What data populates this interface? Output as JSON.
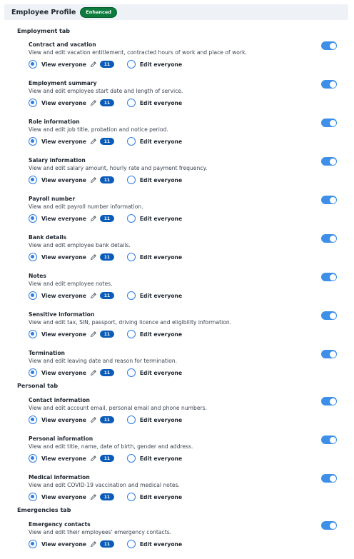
{
  "header": {
    "title": "Employee Profile",
    "badge": "Enhanced"
  },
  "option_labels": {
    "view": "View everyone",
    "edit": "Edit everyone"
  },
  "sections": [
    {
      "title": "Employment tab",
      "items": [
        {
          "title": "Contract and vacation",
          "desc": "View and edit vacation entitlement, contracted hours of work and place of work.",
          "count": "11"
        },
        {
          "title": "Employment summary",
          "desc": "View and edit employee start date and length of service.",
          "count": "11"
        },
        {
          "title": "Role information",
          "desc": "View and edit job title, probation and notice period.",
          "count": "11"
        },
        {
          "title": "Salary information",
          "desc": "View and edit salary amount, hourly rate and payment frequency.",
          "count": "11"
        },
        {
          "title": "Payroll number",
          "desc": "View and edit payroll number information.",
          "count": "11"
        },
        {
          "title": "Bank details",
          "desc": "View and edit employee bank details.",
          "count": "11"
        },
        {
          "title": "Notes",
          "desc": "View and edit employee notes.",
          "count": "11"
        },
        {
          "title": "Sensitive information",
          "desc": "View and edit tax, SIN, passport, driving licence and eligibility information.",
          "count": "11"
        },
        {
          "title": "Termination",
          "desc": "View and edit leaving date and reason for termination.",
          "count": "11"
        }
      ]
    },
    {
      "title": "Personal tab",
      "items": [
        {
          "title": "Contact information",
          "desc": "View and edit account email, personal email and phone numbers.",
          "count": "11"
        },
        {
          "title": "Personal information",
          "desc": "View and edit title, name, date of birth, gender and address.",
          "count": "11"
        },
        {
          "title": "Medical information",
          "desc": "View and edit COVID-19 vaccination and medical notes.",
          "count": "11"
        }
      ]
    },
    {
      "title": "Emergencies tab",
      "items": [
        {
          "title": "Emergency contacts",
          "desc": "View and edit their employees' emergency contacts.",
          "count": "11"
        }
      ]
    }
  ],
  "colors": {
    "accent": "#3d8fe8",
    "count_badge": "#0b5bb8",
    "enhanced_badge": "#0d7a3e",
    "header_bg": "#eef2f7"
  },
  "icons": {
    "edit": "pencil-icon"
  }
}
